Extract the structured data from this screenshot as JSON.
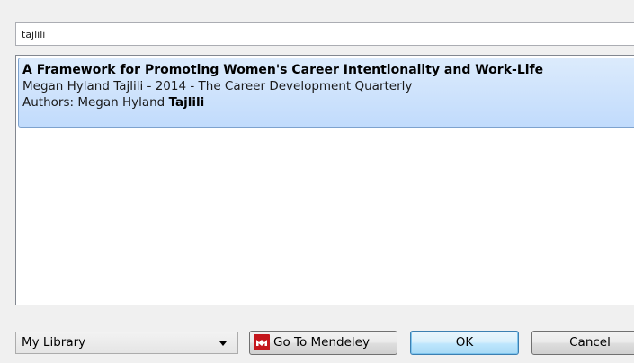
{
  "search": {
    "value": "tajlili"
  },
  "results": [
    {
      "title": "A Framework for Promoting Women's Career Intentionality and Work-Life",
      "meta": "Megan Hyland Tajlili - 2014 - The Career Development Quarterly",
      "authors_prefix": "Authors: Megan Hyland ",
      "authors_highlight": "Tajlili"
    }
  ],
  "footer": {
    "library_selected": "My Library",
    "go_to_mendeley_label": "Go To Mendeley",
    "ok_label": "OK",
    "cancel_label": "Cancel"
  },
  "colors": {
    "selection_bg": "#c1dbfc",
    "selection_border": "#7da2ce",
    "mendeley_logo": "#c4161c"
  },
  "icons": {
    "mendeley_logo": "mendeley-logo-icon",
    "dropdown": "chevron-down-icon"
  }
}
